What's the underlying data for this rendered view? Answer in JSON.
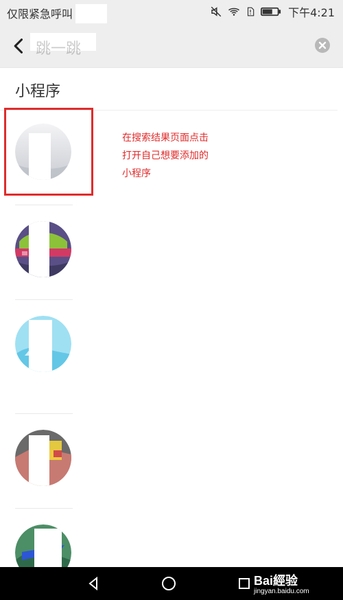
{
  "status": {
    "left_text": "仅限紧急呼叫",
    "time": "下午4:21"
  },
  "header": {
    "title": "跳一跳"
  },
  "section": {
    "title": "小程序"
  },
  "annotation": {
    "text": "在搜索结果页面点击\n打开自己想要添加的\n小程序"
  },
  "watermark": {
    "brand": "Bai經验",
    "site": "jingyan.baidu.com"
  },
  "colors": {
    "highlight": "#e02b2b"
  }
}
